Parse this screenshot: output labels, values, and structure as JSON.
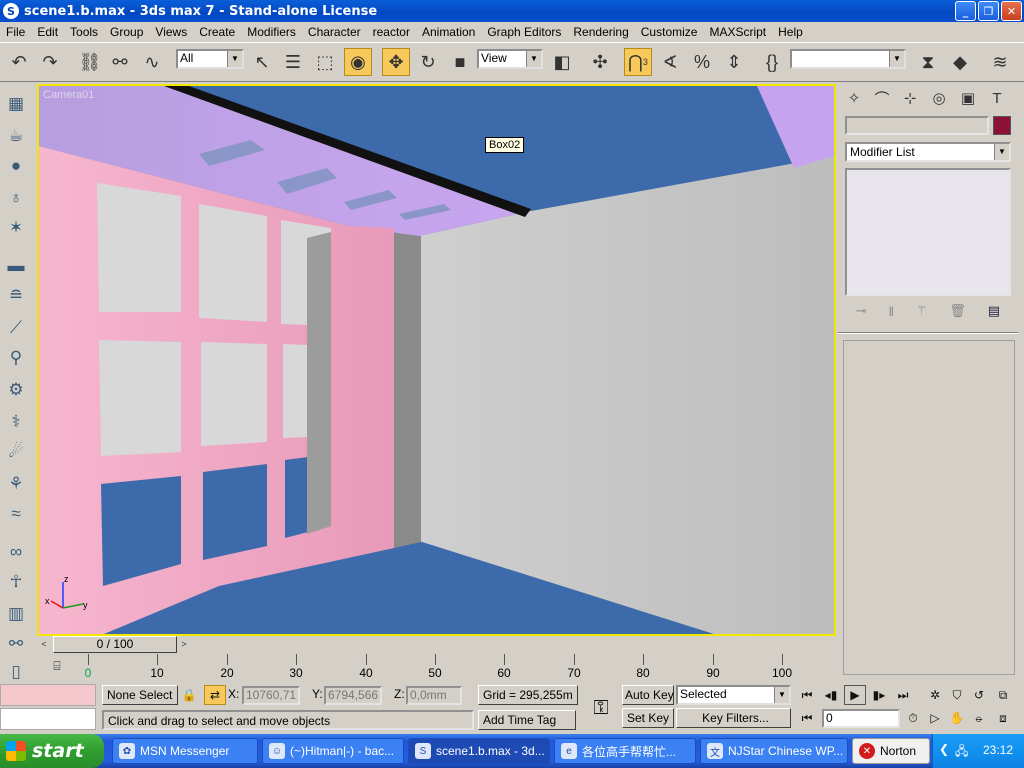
{
  "window": {
    "title": "scene1.b.max - 3ds max 7  - Stand-alone License",
    "min": "_",
    "max": "❐",
    "close": "✕"
  },
  "menu": [
    "File",
    "Edit",
    "Tools",
    "Group",
    "Views",
    "Create",
    "Modifiers",
    "Character",
    "reactor",
    "Animation",
    "Graph Editors",
    "Rendering",
    "Customize",
    "MAXScript",
    "Help"
  ],
  "toolbar": {
    "selection_filter": "All",
    "ref_coord": "View",
    "named_selection": "",
    "snap_badge": "3",
    "spinner_snap": "%"
  },
  "viewport": {
    "label": "Camera01",
    "tooltip": "Box02",
    "axes": {
      "z": "z",
      "y": "y",
      "x": "x"
    }
  },
  "command_panel": {
    "name_field": "",
    "modifier_list": "Modifier List"
  },
  "time_slider": {
    "frame": "0 / 100",
    "prev": "<",
    "next": ">"
  },
  "trackbar": {
    "ticks": [
      "0",
      "10",
      "20",
      "30",
      "40",
      "50",
      "60",
      "70",
      "80",
      "90",
      "100"
    ]
  },
  "status": {
    "selection": "None Select",
    "x_label": "X:",
    "x_value": "10760,71",
    "y_label": "Y:",
    "y_value": "6794,566",
    "z_label": "Z:",
    "z_value": "0,0mm",
    "grid": "Grid = 295,255m",
    "prompt": "Click and drag to select and move objects",
    "add_time_tag": "Add Time Tag",
    "auto_key": "Auto Key",
    "set_key": "Set Key",
    "key_mode": "Selected",
    "key_filters": "Key Filters...",
    "current_frame": "0"
  },
  "taskbar": {
    "start": "start",
    "tasks": [
      "MSN Messenger",
      "(~)Hitman|-) - bac...",
      "scene1.b.max - 3d...",
      "各位高手帮帮忙...",
      "NJStar Chinese WP..."
    ],
    "norton": "Norton",
    "time": "23:12"
  },
  "colors": {
    "viewport_border": "#f3e600",
    "object_color": "#8c1139",
    "floor": "#3d6aaa",
    "wall": "#c8c8c8",
    "window_frame": "#f2a9c2"
  }
}
